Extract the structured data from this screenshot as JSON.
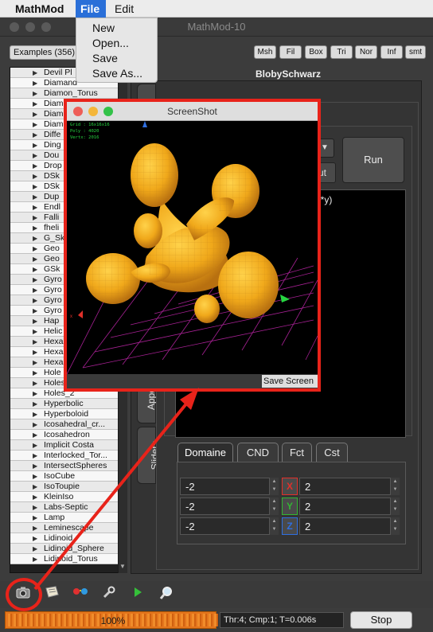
{
  "menubar": {
    "app": "MathMod",
    "file": "File",
    "edit": "Edit"
  },
  "file_menu": [
    "New",
    "Open...",
    "Save",
    "Save As..."
  ],
  "window": {
    "title": "MathMod-10"
  },
  "examples": {
    "label": "Examples (356)"
  },
  "toolbar": [
    "Msh",
    "Fil",
    "Box",
    "Tri",
    "Nor",
    "Inf",
    "smt"
  ],
  "object_title": "BlobySchwarz",
  "list_items": [
    "Devil Pl",
    "Diamand",
    "Diamon_Torus",
    "Diam",
    "Diam",
    "Diam",
    "Diffe",
    "Ding",
    "Dou",
    "Drop",
    "DSk",
    "DSk",
    "Dup",
    "Endl",
    "Falli",
    "fheli",
    "G_Sk",
    "Geo",
    "Geo",
    "GSk",
    "Gyro",
    "Gyro",
    "Gyro",
    "Gyro",
    "Hap",
    "Helic",
    "Hexa",
    "Hexa",
    "Hexa",
    "Hole",
    "Holes",
    "Holes_2",
    "Hyperbolic",
    "Hyperboloid",
    "Icosahedral_cr...",
    "Icosahedron",
    "Implicit Costa",
    "Interlocked_Tor...",
    "IntersectSpheres",
    "IsoCube",
    "IsoToupie",
    "KleinIso",
    "Labs-Septic",
    "Lamp",
    "Leminescape",
    "Lidinoid",
    "Lidinoid_Sphere",
    "Lidinoid_Torus"
  ],
  "side_tabs": {
    "sliders": "Sliders",
    "appearance": "Appe"
  },
  "run_button": "Run",
  "small_button": "ut",
  "equation_fragment": "5*y)",
  "tabs": [
    "Domaine",
    "CND",
    "Fct",
    "Cst"
  ],
  "domain": {
    "rows": [
      {
        "min": "-2",
        "axis": "X",
        "max": "2"
      },
      {
        "min": "-2",
        "axis": "Y",
        "max": "2"
      },
      {
        "min": "-2",
        "axis": "Z",
        "max": "2"
      }
    ]
  },
  "axis_colors": {
    "X": "#e0302a",
    "Y": "#33b533",
    "Z": "#2f6fe0"
  },
  "progress": {
    "label": "100%",
    "value": 100
  },
  "status": "Thr:4; Cmp:1; T=0.006s",
  "stop_button": "Stop",
  "bottom_icons": [
    "camera-icon",
    "scroll-icon",
    "glasses-icon",
    "wrench-icon",
    "play-icon",
    "magnifier-icon"
  ],
  "screenshot_window": {
    "title": "ScreenShot",
    "info_lines": [
      "Grid : 16x16x16",
      "Poly : 4020",
      "Vertx: 2016"
    ],
    "save_label": "Save Screen",
    "axis_label": "x"
  },
  "highlight_color": "#e8231a"
}
